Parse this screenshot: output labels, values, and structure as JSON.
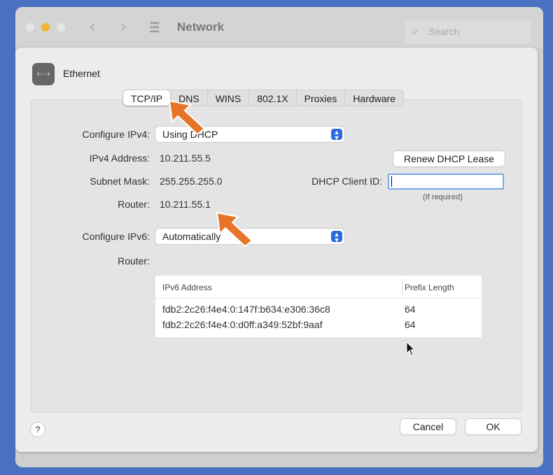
{
  "window": {
    "title": "Network",
    "search_placeholder": "Search",
    "traffic_light_colors": {
      "close": "#e6e6e6",
      "minimize": "#f2b42c",
      "zoom": "#e6e6e6"
    }
  },
  "sheet": {
    "interface_name": "Ethernet",
    "tabs": [
      {
        "label": "TCP/IP",
        "active": true
      },
      {
        "label": "DNS"
      },
      {
        "label": "WINS"
      },
      {
        "label": "802.1X"
      },
      {
        "label": "Proxies"
      },
      {
        "label": "Hardware"
      }
    ],
    "ipv4": {
      "configure_label": "Configure IPv4:",
      "configure_value": "Using DHCP",
      "address_label": "IPv4 Address:",
      "address_value": "10.211.55.5",
      "subnet_label": "Subnet Mask:",
      "subnet_value": "255.255.255.0",
      "router_label": "Router:",
      "router_value": "10.211.55.1",
      "renew_button": "Renew DHCP Lease",
      "client_id_label": "DHCP Client ID:",
      "client_id_value": "",
      "client_id_hint": "(If required)"
    },
    "ipv6": {
      "configure_label": "Configure IPv6:",
      "configure_value": "Automatically",
      "router_label": "Router:",
      "router_value": "",
      "table": {
        "columns": [
          "IPv6 Address",
          "Prefix Length"
        ],
        "rows": [
          [
            "fdb2:2c26:f4e4:0:147f:b634:e306:36c8",
            "64"
          ],
          [
            "fdb2:2c26:f4e4:0:d0ff:a349:52bf:9aaf",
            "64"
          ]
        ]
      }
    },
    "help_label": "?",
    "cancel_button": "Cancel",
    "ok_button": "OK"
  },
  "accent_color": "#2c6bde",
  "annotation_arrow_color": "#e8742a"
}
